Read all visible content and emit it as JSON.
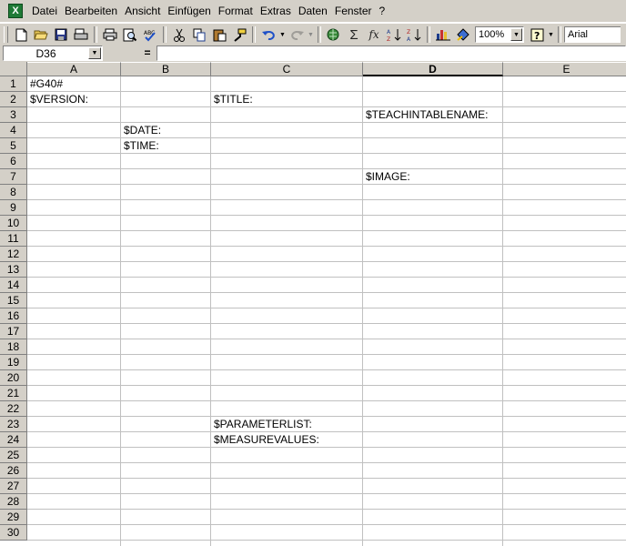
{
  "menu": {
    "items": [
      {
        "label": "Datei"
      },
      {
        "label": "Bearbeiten"
      },
      {
        "label": "Ansicht"
      },
      {
        "label": "Einfügen"
      },
      {
        "label": "Format"
      },
      {
        "label": "Extras"
      },
      {
        "label": "Daten"
      },
      {
        "label": "Fenster"
      },
      {
        "label": "?"
      }
    ]
  },
  "toolbar": {
    "zoom_value": "100%",
    "font_value": "Arial",
    "icons": [
      "new-icon",
      "open-icon",
      "save-icon",
      "print-preview-icon",
      "print-icon",
      "preview-icon",
      "spellcheck-icon",
      "cut-icon",
      "copy-icon",
      "paste-icon",
      "format-painter-icon",
      "undo-icon",
      "redo-icon",
      "hyperlink-icon",
      "autosum-icon",
      "function-icon",
      "sort-ascending-icon",
      "sort-descending-icon",
      "chart-wizard-icon",
      "drawing-icon",
      "help-icon"
    ]
  },
  "formula_bar": {
    "name_box": "D36",
    "equals_label": "=",
    "formula": ""
  },
  "sheet": {
    "columns": [
      "A",
      "B",
      "C",
      "D",
      "E"
    ],
    "active_column": "D",
    "rows": [
      "1",
      "2",
      "3",
      "4",
      "5",
      "6",
      "7",
      "8",
      "9",
      "10",
      "11",
      "12",
      "13",
      "14",
      "15",
      "16",
      "17",
      "18",
      "19",
      "20",
      "21",
      "22",
      "23",
      "24",
      "25",
      "26",
      "27",
      "28",
      "29",
      "30"
    ],
    "cells": [
      {
        "col": "A",
        "row": "1",
        "value": "#G40#"
      },
      {
        "col": "A",
        "row": "2",
        "value": "$VERSION:"
      },
      {
        "col": "C",
        "row": "2",
        "value": "$TITLE:"
      },
      {
        "col": "D",
        "row": "3",
        "value": "$TEACHINTABLENAME:"
      },
      {
        "col": "B",
        "row": "4",
        "value": "$DATE:"
      },
      {
        "col": "B",
        "row": "5",
        "value": "$TIME:"
      },
      {
        "col": "D",
        "row": "7",
        "value": "$IMAGE:"
      },
      {
        "col": "C",
        "row": "23",
        "value": "$PARAMETERLIST:"
      },
      {
        "col": "C",
        "row": "24",
        "value": "$MEASUREVALUES:"
      }
    ]
  }
}
